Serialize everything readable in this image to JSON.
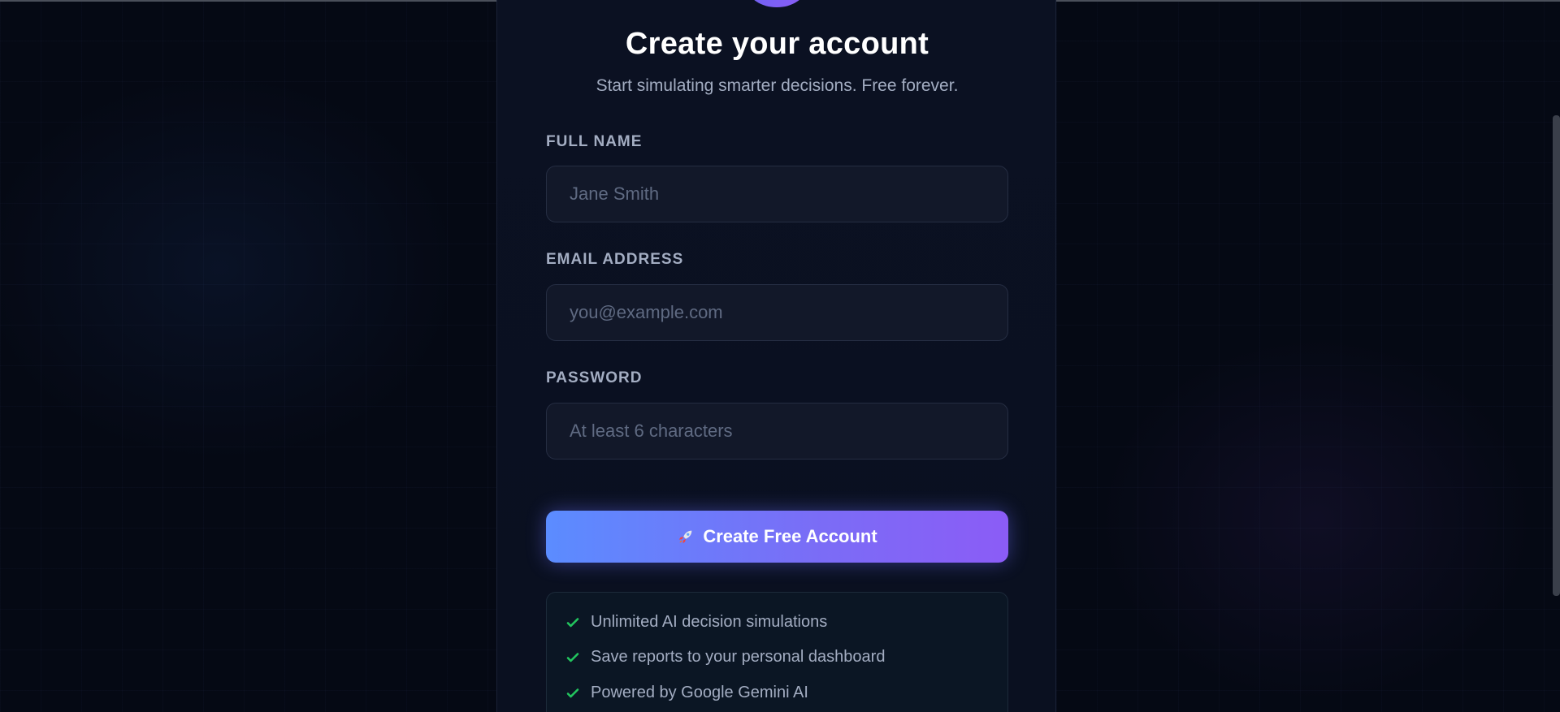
{
  "header": {
    "title": "Create your account",
    "subtitle": "Start simulating smarter decisions. Free forever."
  },
  "form": {
    "full_name": {
      "label": "FULL NAME",
      "value": "",
      "placeholder": "Jane Smith"
    },
    "email": {
      "label": "EMAIL ADDRESS",
      "value": "",
      "placeholder": "you@example.com"
    },
    "password": {
      "label": "PASSWORD",
      "value": "",
      "placeholder": "At least 6 characters"
    },
    "submit_label": "Create Free Account",
    "submit_icon": "rocket-icon"
  },
  "features": {
    "icon": "check-icon",
    "items": [
      "Unlimited AI decision simulations",
      "Save reports to your personal dashboard",
      "Powered by Google Gemini AI"
    ]
  },
  "colors": {
    "background": "#050914",
    "card": "#0b1122",
    "accent_start": "#5b8cff",
    "accent_end": "#8b5cf6",
    "check": "#22c55e",
    "label": "#a3adc2"
  }
}
